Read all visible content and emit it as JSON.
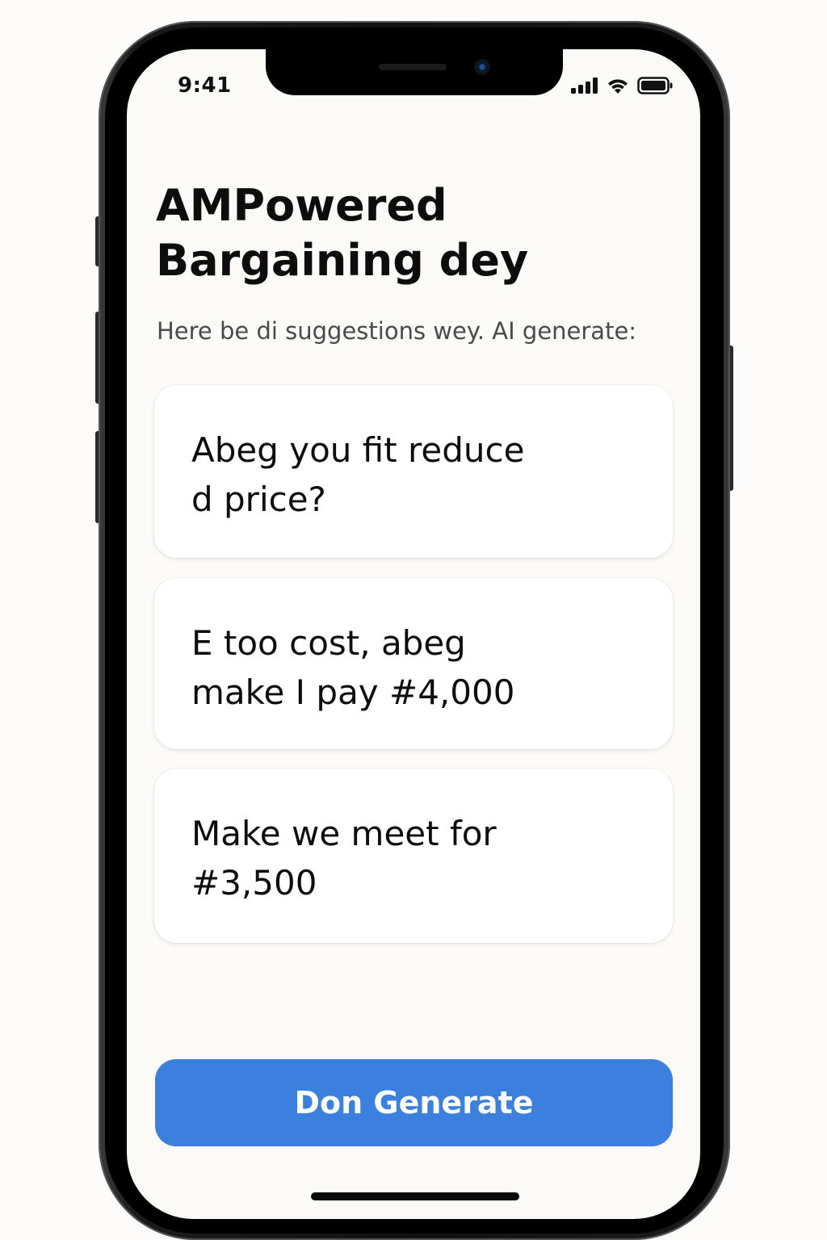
{
  "status_bar": {
    "time": "9:41",
    "icons": [
      "cellular-signal-icon",
      "wifi-icon",
      "battery-icon"
    ]
  },
  "header": {
    "title": "AMPowered Bargaining dey",
    "subtitle": "Here be di suggestions wey. AI generate:"
  },
  "suggestions": [
    {
      "text": "Abeg you fit reduce d price?"
    },
    {
      "text": "E too cost, abeg make I pay #4,000"
    },
    {
      "text": "Make we meet for #3,500"
    }
  ],
  "actions": {
    "generate_label": "Don Generate"
  },
  "colors": {
    "accent": "#3b7fdf",
    "screen_background": "#fbfaf7",
    "card_background": "#ffffff",
    "text_primary": "#0d0d0d",
    "text_secondary": "#4a4a4a"
  }
}
